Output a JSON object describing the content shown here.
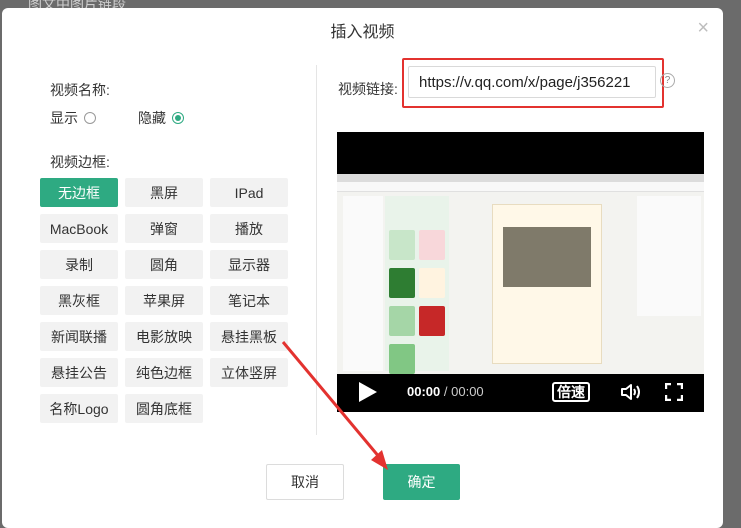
{
  "backdrop": {
    "text": "图文中图片链段"
  },
  "dialog": {
    "title": "插入视频",
    "close_symbol": "×"
  },
  "left": {
    "name_label": "视频名称:",
    "show_label": "显示",
    "hide_label": "隐藏",
    "selected_visibility": "隐藏",
    "frame_label": "视频边框:",
    "frames": [
      "无边框",
      "黑屏",
      "IPad",
      "MacBook",
      "弹窗",
      "播放",
      "录制",
      "圆角",
      "显示器",
      "黑灰框",
      "苹果屏",
      "笔记本",
      "新闻联播",
      "电影放映",
      "悬挂黑板",
      "悬挂公告",
      "纯色边框",
      "立体竖屏",
      "名称Logo",
      "圆角底框"
    ],
    "active_frame": "无边框"
  },
  "right": {
    "link_label": "视频链接:",
    "link_value": "https://v.qq.com/x/page/j356221",
    "help_symbol": "?"
  },
  "player": {
    "current_time": "00:00",
    "separator": "/",
    "duration": "00:00",
    "speed_label": "倍速"
  },
  "footer": {
    "cancel_label": "取消",
    "ok_label": "确定"
  },
  "colors": {
    "accent": "#2eaa82",
    "highlight_border": "#e3322f"
  }
}
